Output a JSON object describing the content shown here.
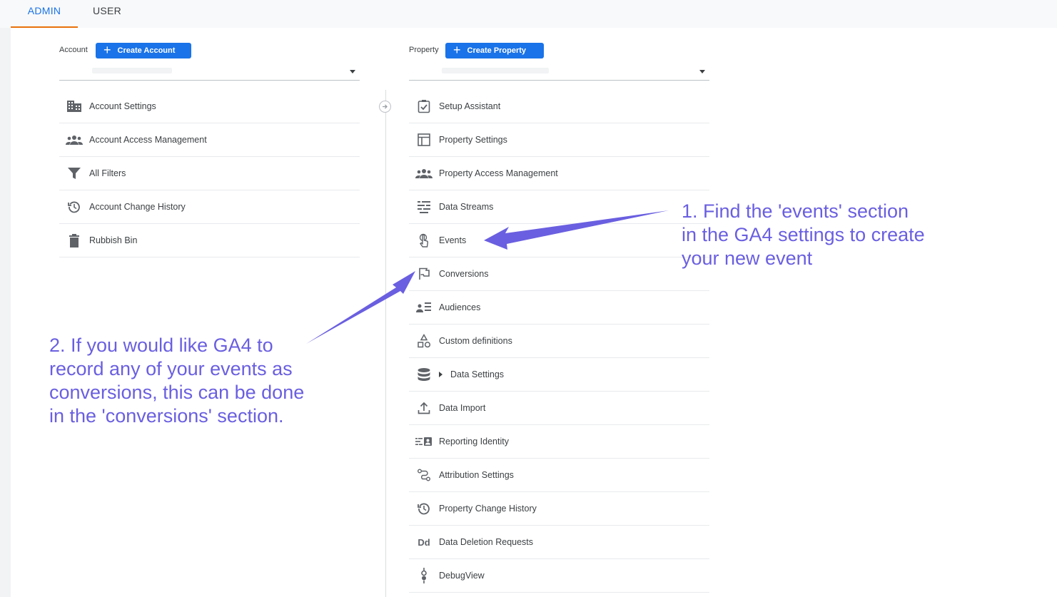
{
  "tabs": [
    {
      "label": "ADMIN",
      "active": true
    },
    {
      "label": "USER",
      "active": false
    }
  ],
  "account": {
    "header_label": "Account",
    "create_label": "Create Account",
    "items": [
      {
        "label": "Account Settings",
        "icon": "building-icon"
      },
      {
        "label": "Account Access Management",
        "icon": "people-icon"
      },
      {
        "label": "All Filters",
        "icon": "filter-icon"
      },
      {
        "label": "Account Change History",
        "icon": "history-icon"
      },
      {
        "label": "Rubbish Bin",
        "icon": "trash-icon"
      }
    ]
  },
  "property": {
    "header_label": "Property",
    "create_label": "Create Property",
    "items": [
      {
        "label": "Setup Assistant",
        "icon": "checkbox-icon"
      },
      {
        "label": "Property Settings",
        "icon": "layout-icon"
      },
      {
        "label": "Property Access Management",
        "icon": "people-icon"
      },
      {
        "label": "Data Streams",
        "icon": "streams-icon"
      },
      {
        "label": "Events",
        "icon": "touch-icon"
      },
      {
        "label": "Conversions",
        "icon": "flag-icon"
      },
      {
        "label": "Audiences",
        "icon": "audience-icon"
      },
      {
        "label": "Custom definitions",
        "icon": "shapes-icon"
      },
      {
        "label": "Data Settings",
        "icon": "database-icon"
      },
      {
        "label": "Data Import",
        "icon": "upload-icon"
      },
      {
        "label": "Reporting Identity",
        "icon": "identity-icon"
      },
      {
        "label": "Attribution Settings",
        "icon": "attribution-icon"
      },
      {
        "label": "Property Change History",
        "icon": "history-icon"
      },
      {
        "label": "Data Deletion Requests",
        "icon": "dd-icon"
      },
      {
        "label": "DebugView",
        "icon": "debug-icon"
      }
    ]
  },
  "annotations": {
    "one": [
      "1. Find the 'events' section",
      "in the GA4 settings to create",
      "your new event"
    ],
    "two": [
      "2. If you would like GA4 to",
      "record any of your events as",
      "conversions, this can be done",
      "in the 'conversions' section."
    ]
  },
  "colors": {
    "accent": "#1a73e8",
    "tab_indicator": "#e8710a",
    "annotation": "#6a5fe0"
  }
}
